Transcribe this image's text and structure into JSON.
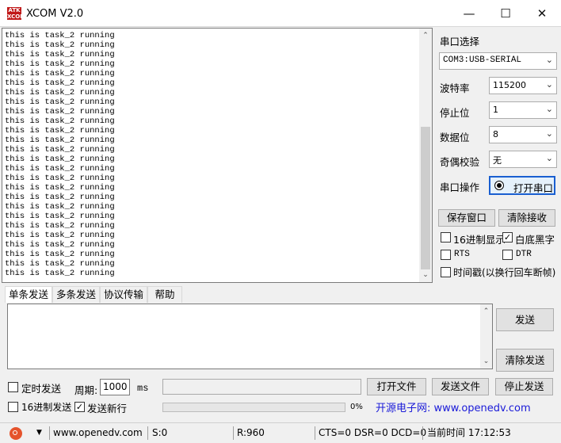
{
  "window": {
    "title": "XCOM V2.0",
    "icon_text": "ATK XCOM"
  },
  "receive": {
    "lines": [
      "this is task_2 running",
      "this is task_2 running",
      "this is task_2 running",
      "this is task_2 running",
      "this is task_2 running",
      "this is task_2 running",
      "this is task_2 running",
      "this is task_2 running",
      "this is task_2 running",
      "this is task_2 running",
      "this is task_2 running",
      "this is task_2 running",
      "this is task_2 running",
      "this is task_2 running",
      "this is task_2 running",
      "this is task_2 running",
      "this is task_2 running",
      "this is task_2 running",
      "this is task_2 running",
      "this is task_2 running",
      "this is task_2 running",
      "this is task_2 running",
      "this is task_2 running",
      "this is task_2 running",
      "this is task_2 running",
      "this is task_2 running"
    ]
  },
  "settings": {
    "port_label": "串口选择",
    "port_value": "COM3:USB-SERIAL",
    "baud_label": "波特率",
    "baud_value": "115200",
    "stop_label": "停止位",
    "stop_value": "1",
    "data_label": "数据位",
    "data_value": "8",
    "parity_label": "奇偶校验",
    "parity_value": "无",
    "op_label": "串口操作",
    "open_button": "打开串口",
    "save_button": "保存窗口",
    "clear_recv_button": "清除接收",
    "hex_display": "16进制显示",
    "white_black": "白底黑字",
    "rts": "RTS",
    "dtr": "DTR",
    "timestamp": "时间戳(以换行回车断帧)"
  },
  "tabs": [
    "单条发送",
    "多条发送",
    "协议传输",
    "帮助"
  ],
  "send": {
    "send_button": "发送",
    "clear_send_button": "清除发送",
    "timed_send": "定时发送",
    "period_label": "周期:",
    "period_value": "1000",
    "period_unit": "ms",
    "open_file_button": "打开文件",
    "send_file_button": "发送文件",
    "stop_send_button": "停止发送",
    "hex_send": "16进制发送",
    "newline": "发送新行",
    "progress_text": "0%",
    "progress": 0,
    "website": "开源电子网: www.openedv.com"
  },
  "status": {
    "url": "www.openedv.com",
    "sent": "S:0",
    "received": "R:960",
    "lines": "CTS=0 DSR=0 DCD=0",
    "time": "当前时间 17:12:53"
  },
  "colors": {
    "website": "#1a1ad8",
    "radio": "#1a5fd0"
  }
}
